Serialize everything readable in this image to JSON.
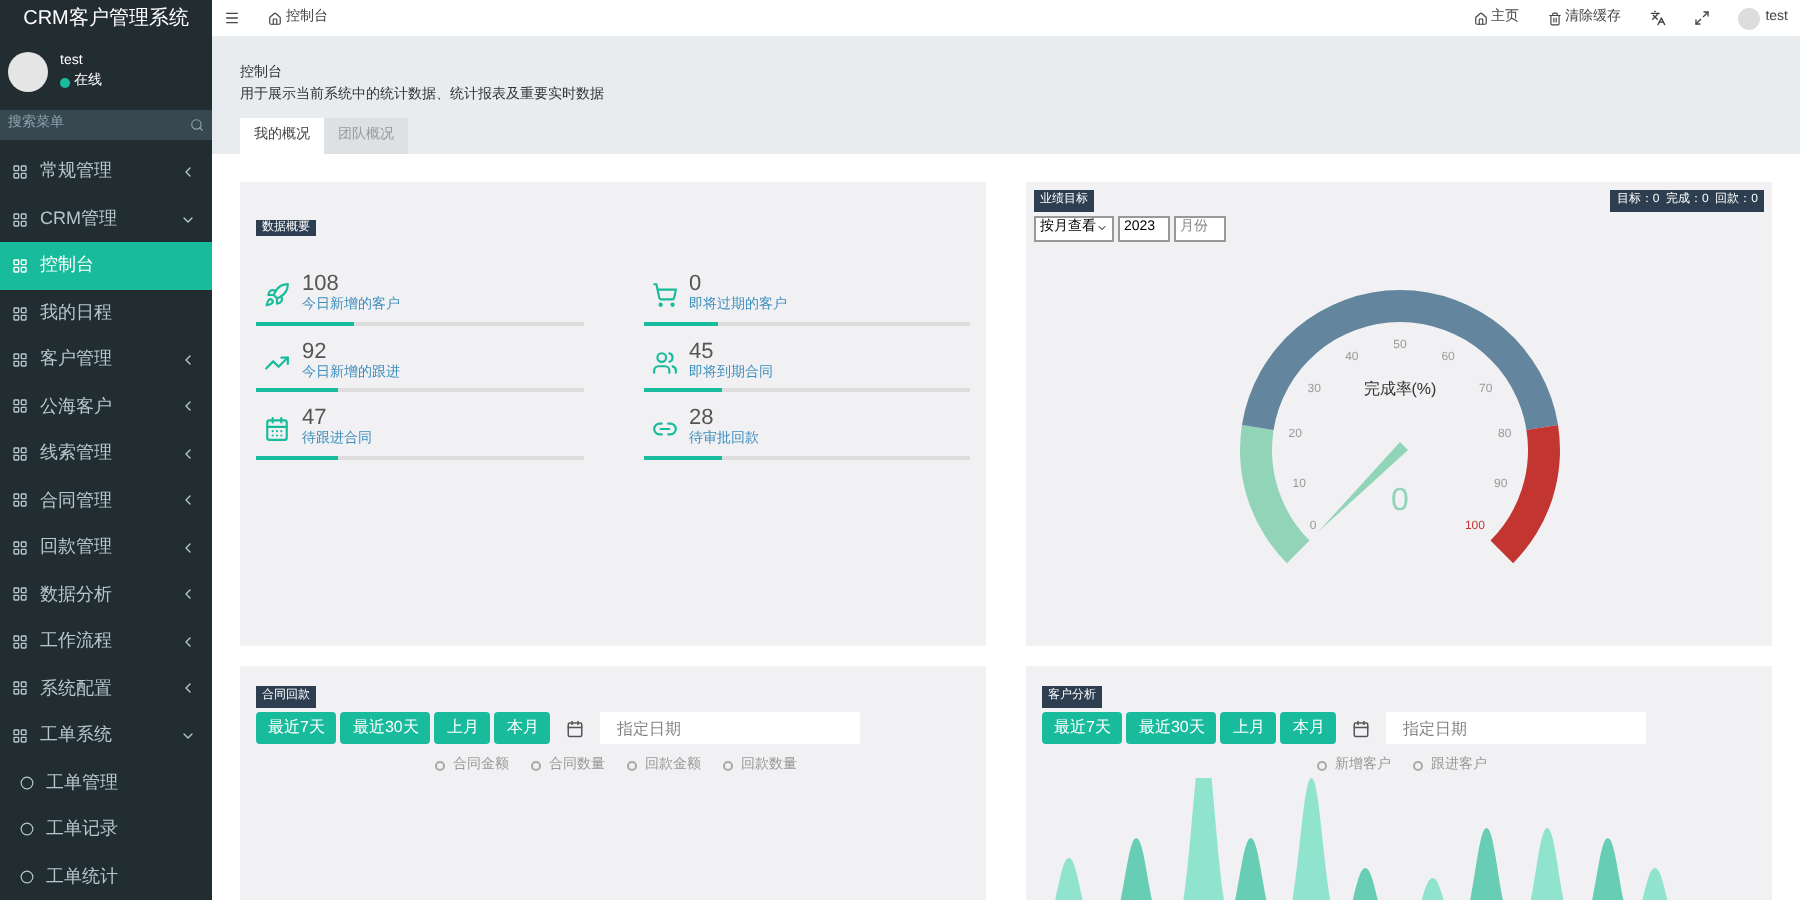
{
  "sidebar": {
    "brand": "CRM客户管理系统",
    "user": {
      "name": "test",
      "status": "在线",
      "online": true
    },
    "search": {
      "placeholder": "搜索菜单"
    },
    "items": [
      {
        "label": "常规管理",
        "selected": false,
        "expanded": false
      },
      {
        "label": "CRM管理",
        "selected": false,
        "expanded": true,
        "children": [
          {
            "label": "控制台",
            "selected": true
          },
          {
            "label": "我的日程",
            "selected": false
          },
          {
            "label": "客户管理",
            "selected": false,
            "expanded": false
          },
          {
            "label": "公海客户",
            "selected": false,
            "expanded": false
          },
          {
            "label": "线索管理",
            "selected": false,
            "expanded": false
          },
          {
            "label": "合同管理",
            "selected": false,
            "expanded": false
          },
          {
            "label": "回款管理",
            "selected": false,
            "expanded": false
          },
          {
            "label": "数据分析",
            "selected": false,
            "expanded": false
          },
          {
            "label": "工作流程",
            "selected": false,
            "expanded": false
          },
          {
            "label": "系统配置",
            "selected": false,
            "expanded": false
          }
        ]
      },
      {
        "label": "工单系统",
        "selected": false,
        "expanded": true,
        "children": [
          {
            "label": "工单管理",
            "selected": false
          },
          {
            "label": "工单记录",
            "selected": false
          },
          {
            "label": "工单统计",
            "selected": false
          }
        ]
      }
    ]
  },
  "topbar": {
    "tab": "控制台",
    "links": [
      "主页",
      "清除缓存"
    ],
    "user": "test"
  },
  "page": {
    "title": "控制台",
    "description": "用于展示当前系统中的统计数据、统计报表及重要实时数据",
    "tabs": [
      {
        "label": "我的概况",
        "selected": true
      },
      {
        "label": "团队概况",
        "selected": false
      }
    ]
  },
  "summary": {
    "title": "数据概要",
    "stats": [
      {
        "value": "108",
        "label": "今日新增的客户",
        "kind": "rocket",
        "level": 0.3
      },
      {
        "value": "0",
        "label": "即将过期的客户",
        "kind": "cart",
        "level": 0.23
      },
      {
        "value": "92",
        "label": "今日新增的跟进",
        "kind": "chart",
        "level": 0.25
      },
      {
        "value": "45",
        "label": "即将到期合同",
        "kind": "users",
        "level": 0.24
      },
      {
        "value": "47",
        "label": "待跟进合同",
        "kind": "calendar",
        "level": 0.25
      },
      {
        "value": "28",
        "label": "待审批回款",
        "kind": "link",
        "level": 0.24
      }
    ]
  },
  "goal": {
    "title": "业绩目标",
    "badge": "目标：0  完成：0  回款：0",
    "period": "按月查看",
    "year": "2023",
    "month_placeholder": "月份",
    "gauge_title": "完成率(%)",
    "gauge_value": "0",
    "ticks": [
      "0",
      "10",
      "20",
      "30",
      "40",
      "50",
      "60",
      "70",
      "80",
      "90",
      "100"
    ]
  },
  "contracts": {
    "title": "合同回款",
    "buttons": [
      "最近7天",
      "最近30天",
      "上月",
      "本月"
    ],
    "date_placeholder": "指定日期",
    "legend": [
      "合同金额",
      "合同数量",
      "回款金额",
      "回款数量"
    ]
  },
  "customers": {
    "title": "客户分析",
    "buttons": [
      "最近7天",
      "最近30天",
      "上月",
      "本月"
    ],
    "date_placeholder": "指定日期",
    "legend": [
      "新增客户",
      "跟进客户"
    ]
  }
}
